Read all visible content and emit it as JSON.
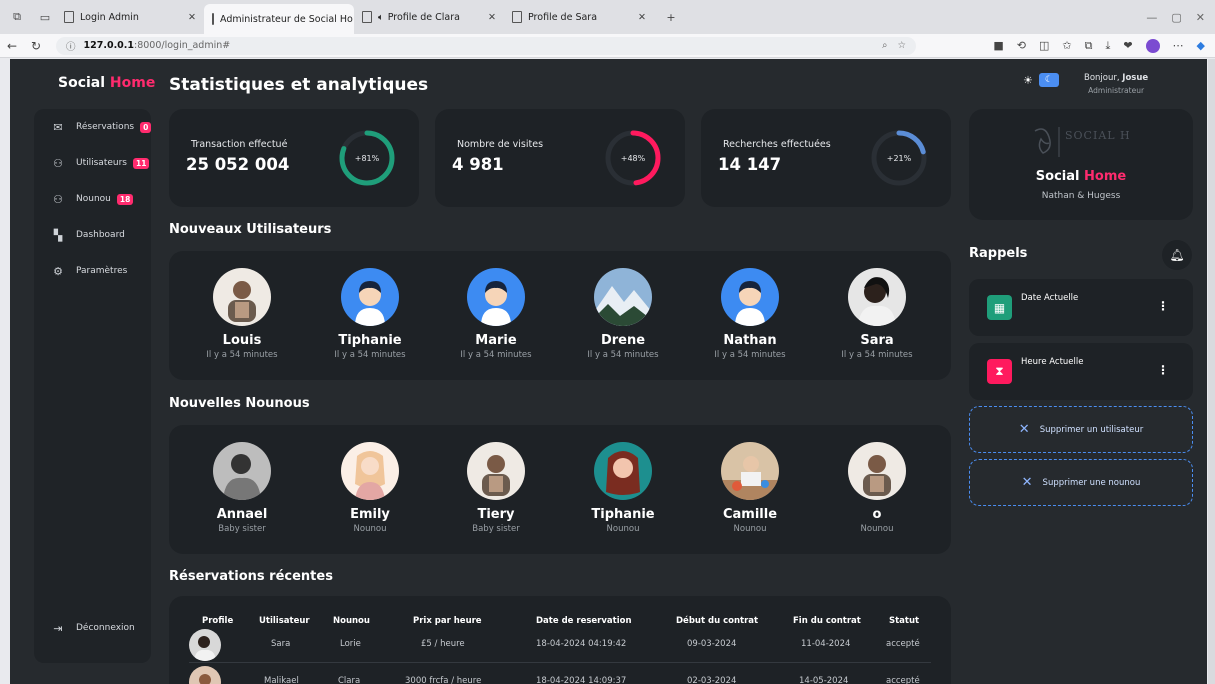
{
  "browser": {
    "tabs": [
      {
        "label": "Login Admin",
        "active": false
      },
      {
        "label": "Administrateur de Social Ho",
        "active": true
      },
      {
        "label": "Profile de Clara",
        "active": false
      },
      {
        "label": "Profile de Sara",
        "active": false
      }
    ],
    "url_host": "127.0.0.1",
    "url_path": ":8000/login_admin#"
  },
  "brand": {
    "name": "Social",
    "accent": "Home"
  },
  "sidebar": {
    "items": [
      {
        "label": "Réservations",
        "badge": "0",
        "icon": "mail-icon"
      },
      {
        "label": "Utilisateurs",
        "badge": "11",
        "icon": "user-icon"
      },
      {
        "label": "Nounou",
        "badge": "18",
        "icon": "user-icon"
      },
      {
        "label": "Dashboard",
        "badge": "",
        "icon": "dashboard-icon"
      },
      {
        "label": "Paramètres",
        "badge": "",
        "icon": "gear-icon"
      }
    ],
    "logout": "Déconnexion"
  },
  "page": {
    "title": "Statistiques et analytiques"
  },
  "stats": [
    {
      "label": "Transaction effectué",
      "value": "25 052 004",
      "percent": "+81%",
      "fraction": 0.81,
      "color": "#1f9e7a"
    },
    {
      "label": "Nombre de visites",
      "value": "4 981",
      "percent": "+48%",
      "fraction": 0.48,
      "color": "#ff1a5e"
    },
    {
      "label": "Recherches effectuées",
      "value": "14 147",
      "percent": "+21%",
      "fraction": 0.21,
      "color": "#5b8dd6"
    }
  ],
  "new_users": {
    "title": "Nouveaux Utilisateurs",
    "items": [
      {
        "name": "Louis",
        "sub": "Il y a 54 minutes"
      },
      {
        "name": "Tiphanie",
        "sub": "Il y a 54 minutes"
      },
      {
        "name": "Marie",
        "sub": "Il y a 54 minutes"
      },
      {
        "name": "Drene",
        "sub": "Il y a 54 minutes"
      },
      {
        "name": "Nathan",
        "sub": "Il y a 54 minutes"
      },
      {
        "name": "Sara",
        "sub": "Il y a 54 minutes"
      }
    ]
  },
  "new_nannies": {
    "title": "Nouvelles Nounous",
    "items": [
      {
        "name": "Annael",
        "sub": "Baby sister"
      },
      {
        "name": "Emily",
        "sub": "Nounou"
      },
      {
        "name": "Tiery",
        "sub": "Baby sister"
      },
      {
        "name": "Tiphanie",
        "sub": "Nounou"
      },
      {
        "name": "Camille",
        "sub": "Nounou"
      },
      {
        "name": "o",
        "sub": "Nounou"
      }
    ]
  },
  "reservations": {
    "title": "Réservations récentes",
    "columns": [
      "Profile",
      "Utilisateur",
      "Nounou",
      "Prix par heure",
      "Date de reservation",
      "Début du contrat",
      "Fin du contrat",
      "Statut"
    ],
    "rows": [
      [
        "",
        "Sara",
        "Lorie",
        "£5 / heure",
        "18-04-2024 04:19:42",
        "09-03-2024",
        "11-04-2024",
        "accepté"
      ],
      [
        "",
        "Malikael",
        "Clara",
        "3000 frcfa / heure",
        "18-04-2024 14:09:37",
        "02-03-2024",
        "14-05-2024",
        "accepté"
      ]
    ]
  },
  "header": {
    "greeting": "Bonjour,",
    "user": "Josue",
    "role": "Administrateur"
  },
  "brand_card": {
    "logo_text": "SOCIAL HOME",
    "name": "Social",
    "accent": "Home",
    "subtitle": "Nathan & Hugess"
  },
  "reminders": {
    "title": "Rappels",
    "items": [
      {
        "label": "Date Actuelle",
        "color": "#1f9e7a",
        "icon": "calendar-icon"
      },
      {
        "label": "Heure Actuelle",
        "color": "#ff1a5e",
        "icon": "hourglass-icon"
      }
    ]
  },
  "actions": {
    "delete_user": "Supprimer un utilisateur",
    "delete_nanny": "Supprimer une nounou"
  }
}
